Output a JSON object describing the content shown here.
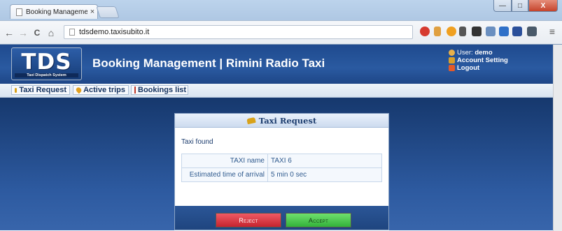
{
  "browser": {
    "tab_title": "Booking Management",
    "tab_close": "×",
    "url": "tdsdemo.taxisubito.it",
    "nav": {
      "back": "←",
      "forward": "→",
      "reload": "C",
      "home": "⌂"
    },
    "window_buttons": {
      "minimize": "—",
      "maximize": "□",
      "close": "X"
    },
    "menu_glyph": "≡"
  },
  "header": {
    "logo_main": "TDS",
    "logo_sub": "Taxi Dispatch System",
    "title": "Booking Management | Rimini Radio Taxi",
    "user_label": "User:",
    "user_name": "demo",
    "account_setting": "Account Setting",
    "logout": "Logout"
  },
  "menu": {
    "items": [
      {
        "label": "Taxi Request",
        "icon": "taxi-icon"
      },
      {
        "label": "Active trips",
        "icon": "map-pin-icon"
      },
      {
        "label": "Bookings list",
        "icon": "calendar-icon"
      }
    ]
  },
  "dialog": {
    "title": "Taxi Request",
    "message": "Taxi found",
    "rows": [
      {
        "label": "TAXI name",
        "value": "TAXI 6"
      },
      {
        "label": "Estimated time of arrival",
        "value": "5 min 0 sec"
      }
    ],
    "reject_label": "Reject",
    "accept_label": "Accept"
  },
  "colors": {
    "header_blue": "#2a5aa1",
    "reject_red": "#d43a44",
    "accept_green": "#45c24a"
  }
}
